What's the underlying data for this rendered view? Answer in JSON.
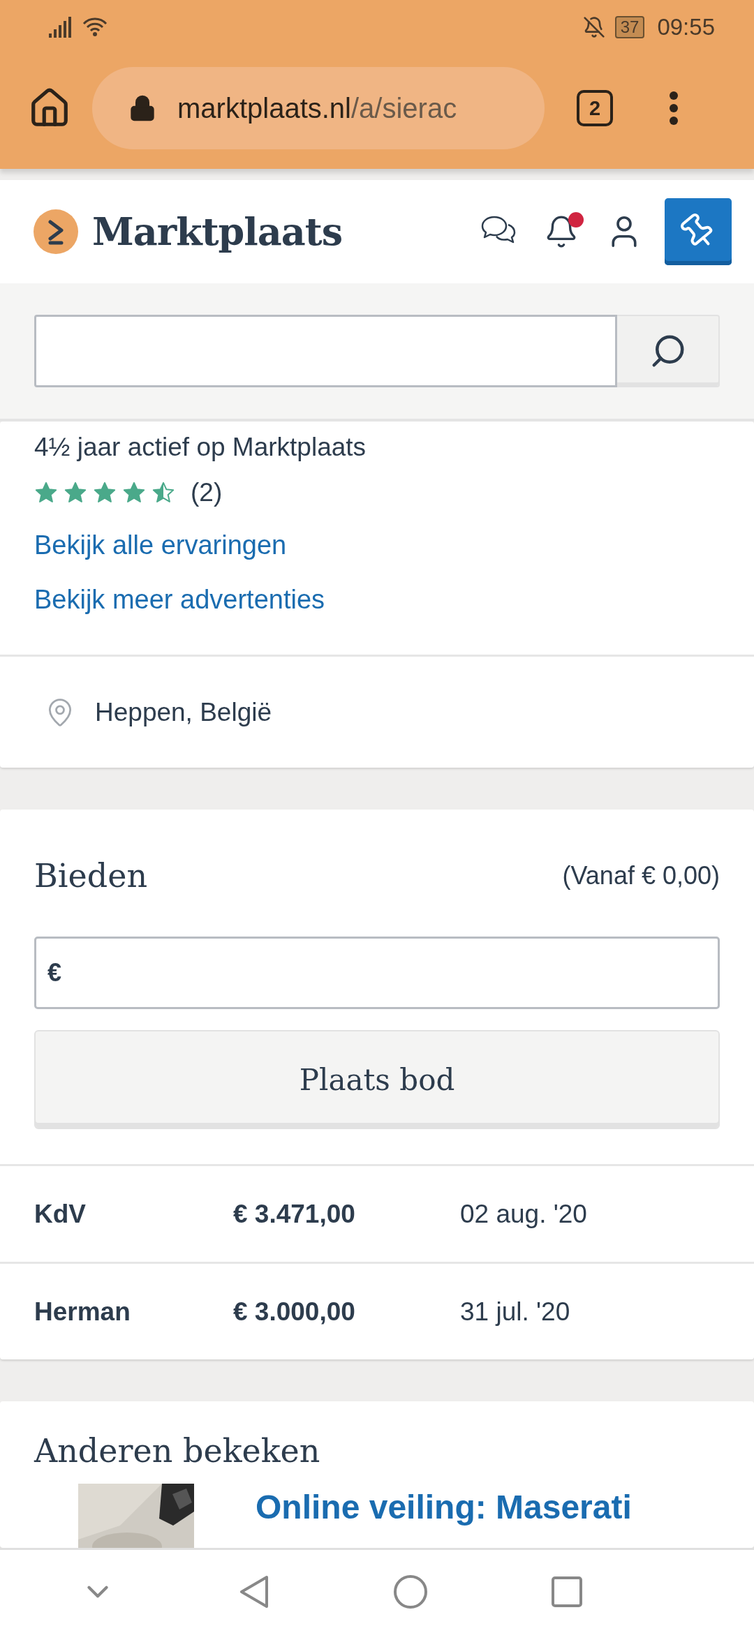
{
  "status_bar": {
    "time": "09:55",
    "battery": "37"
  },
  "browser": {
    "url_host": "marktplaats.nl",
    "url_path": "/a/sierac",
    "tab_count": "2"
  },
  "header": {
    "logo": "Marktplaats",
    "notification_dot": true
  },
  "seller": {
    "active": "4½ jaar actief op Marktplaats",
    "stars": 4.5,
    "review_count": "(2)",
    "links": [
      "Bekijk alle ervaringen",
      "Bekijk meer advertenties"
    ],
    "location": "Heppen, België"
  },
  "bidding": {
    "title": "Bieden",
    "minimum": "(Vanaf € 0,00)",
    "currency": "€",
    "button": "Plaats bod",
    "bids": [
      {
        "bidder": "KdV",
        "amount": "€ 3.471,00",
        "date": "02 aug. '20"
      },
      {
        "bidder": "Herman",
        "amount": "€ 3.000,00",
        "date": "31 jul. '20"
      }
    ]
  },
  "related": {
    "title": "Anderen bekeken",
    "items": [
      {
        "title": "Online veiling: Maserati"
      }
    ]
  }
}
